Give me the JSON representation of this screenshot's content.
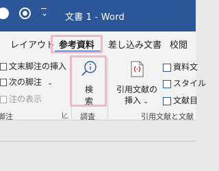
{
  "title_bar": {
    "title": "文書 1  -  Word",
    "qat_caret": "⌄"
  },
  "tabs": [
    {
      "label": "レイアウト"
    },
    {
      "label": "参考資料"
    },
    {
      "label": "差し込み文書"
    },
    {
      "label": "校閲"
    }
  ],
  "footnotes_group": {
    "insert_endnote_label": "文末脚注の挿入",
    "next_footnote_label": "次の脚注",
    "show_notes_label": "注の表示",
    "group_label": "脚注"
  },
  "research_group": {
    "search_label_line1": "検",
    "search_label_line2": "索",
    "group_label": "調査"
  },
  "citations_group": {
    "insert_citation_line1": "引用文献の",
    "insert_citation_line2": "挿入",
    "manage_sources_label": "資料文",
    "style_label": "スタイル",
    "bibliography_label": "文献目",
    "group_label": "引用文献と文献"
  },
  "colors": {
    "titlebar": "#2b579a",
    "highlight": "#f1b6cc",
    "ribbon_bg": "#f3f3f3"
  }
}
